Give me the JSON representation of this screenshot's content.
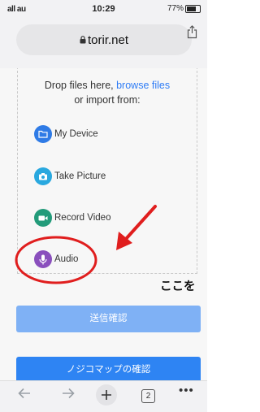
{
  "status_bar": {
    "carrier": "all au",
    "time": "10:29",
    "battery": "77%"
  },
  "browser": {
    "url": "torir.net"
  },
  "upload": {
    "drop_text": "Drop files here, ",
    "browse_link": "browse files",
    "import_text": "or import from:",
    "sources": [
      {
        "label": "My Device",
        "icon": "folder-icon",
        "color": "#2f7be6"
      },
      {
        "label": "Take Picture",
        "icon": "camera-icon",
        "color": "#29a8df"
      },
      {
        "label": "Record Video",
        "icon": "video-camera-icon",
        "color": "#239b7a"
      },
      {
        "label": "Audio",
        "icon": "microphone-icon",
        "color": "#8a4fbd"
      }
    ]
  },
  "buttons": {
    "send_confirm": "送信確認",
    "map_confirm": "ノジコマップの確認"
  },
  "annotation": {
    "text": "ここを",
    "color": "#e01e1e"
  },
  "toolbar": {
    "tab_count": "2"
  }
}
